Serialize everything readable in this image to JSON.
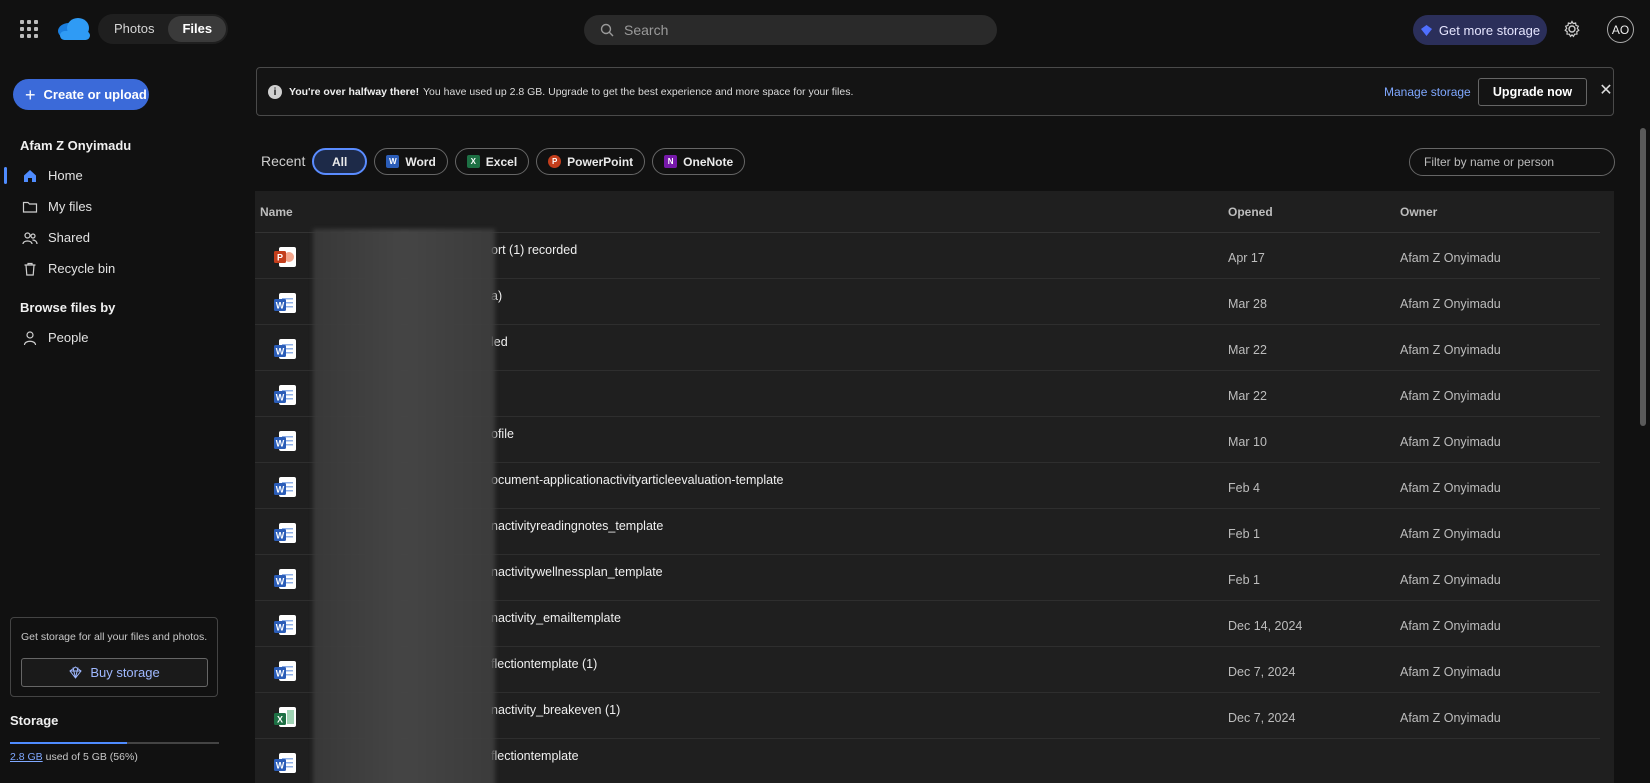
{
  "topbar": {
    "tabs": [
      {
        "label": "Photos",
        "active": false
      },
      {
        "label": "Files",
        "active": true
      }
    ],
    "search_placeholder": "Search",
    "get_storage_label": "Get more storage",
    "avatar_initials": "AO"
  },
  "sidebar": {
    "create_label": "Create or upload",
    "user_name": "Afam Z Onyimadu",
    "nav": [
      {
        "label": "Home",
        "icon": "home-icon",
        "active": true
      },
      {
        "label": "My files",
        "icon": "folder-icon",
        "active": false
      },
      {
        "label": "Shared",
        "icon": "shared-icon",
        "active": false
      },
      {
        "label": "Recycle bin",
        "icon": "recycle-bin-icon",
        "active": false
      }
    ],
    "browse_title": "Browse files by",
    "people_label": "People",
    "promo_text": "Get storage for all your files and photos.",
    "buy_label": "Buy storage",
    "storage_title": "Storage",
    "storage_used": "2.8 GB",
    "storage_rest": " used of 5 GB (56%)",
    "storage_fraction": 0.56
  },
  "banner": {
    "bold": "You're over halfway there!",
    "message": "You have used up 2.8 GB. Upgrade to get the best experience and more space for your files.",
    "manage_label": "Manage storage",
    "upgrade_label": "Upgrade now"
  },
  "filters": {
    "recent_label": "Recent",
    "chips": [
      {
        "label": "All",
        "active": true,
        "icon": ""
      },
      {
        "label": "Word",
        "active": false,
        "icon": "W"
      },
      {
        "label": "Excel",
        "active": false,
        "icon": "X"
      },
      {
        "label": "PowerPoint",
        "active": false,
        "icon": "P"
      },
      {
        "label": "OneNote",
        "active": false,
        "icon": "N"
      }
    ],
    "filter_placeholder": "Filter by name or person"
  },
  "table": {
    "headers": {
      "name": "Name",
      "opened": "Opened",
      "owner": "Owner"
    },
    "rows": [
      {
        "type": "powerpoint",
        "name": "ort (1) recorded",
        "opened": "Apr 17",
        "owner": "Afam Z Onyimadu"
      },
      {
        "type": "word",
        "name": "a)",
        "opened": "Mar 28",
        "owner": "Afam Z Onyimadu"
      },
      {
        "type": "word",
        "name": "led",
        "opened": "Mar 22",
        "owner": "Afam Z Onyimadu"
      },
      {
        "type": "word",
        "name": "",
        "opened": "Mar 22",
        "owner": "Afam Z Onyimadu"
      },
      {
        "type": "word",
        "name": "ofile",
        "opened": "Mar 10",
        "owner": "Afam Z Onyimadu"
      },
      {
        "type": "word",
        "name": "ocument-applicationactivityarticleevaluation-template",
        "opened": "Feb 4",
        "owner": "Afam Z Onyimadu"
      },
      {
        "type": "word",
        "name": "nactivityreadingnotes_template",
        "opened": "Feb 1",
        "owner": "Afam Z Onyimadu"
      },
      {
        "type": "word",
        "name": "nactivitywellnessplan_template",
        "opened": "Feb 1",
        "owner": "Afam Z Onyimadu"
      },
      {
        "type": "word",
        "name": "nactivity_emailtemplate",
        "opened": "Dec 14, 2024",
        "owner": "Afam Z Onyimadu"
      },
      {
        "type": "word",
        "name": "flectiontemplate (1)",
        "opened": "Dec 7, 2024",
        "owner": "Afam Z Onyimadu"
      },
      {
        "type": "excel",
        "name": "nactivity_breakeven (1)",
        "opened": "Dec 7, 2024",
        "owner": "Afam Z Onyimadu"
      },
      {
        "type": "word",
        "name": "flectiontemplate",
        "opened": "",
        "owner": ""
      }
    ]
  },
  "colors": {
    "accent": "#4f8cff",
    "word": "#2b5db8",
    "excel": "#1d7044",
    "powerpoint": "#c43e1c",
    "onenote": "#7719aa"
  }
}
